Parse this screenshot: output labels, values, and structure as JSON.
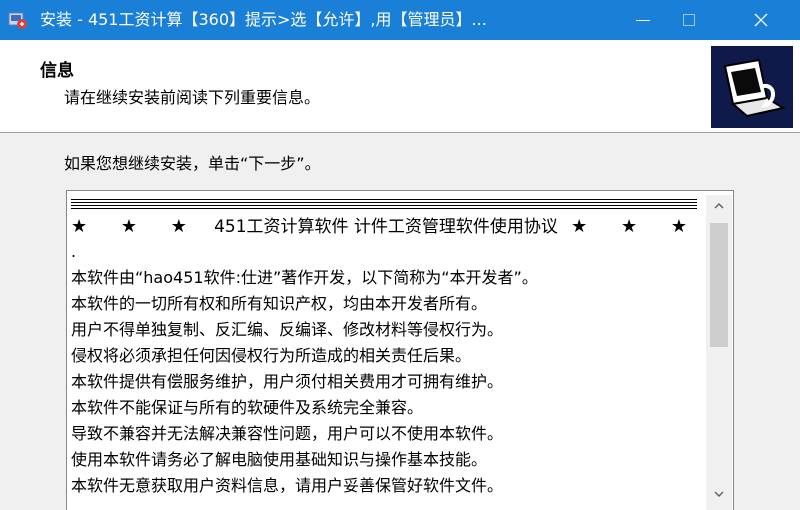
{
  "window": {
    "title": "安装 - 451工资计算【360】提示>选【允许】,用【管理员】..."
  },
  "header": {
    "title": "信息",
    "subtitle": "请在继续安装前阅读下列重要信息。"
  },
  "instruction": "如果您想继续安装，单击“下一步”。",
  "license": {
    "heading_left": "★ ★ ★",
    "heading": "451工资计算软件 计件工资管理软件使用协议",
    "heading_right": "★ ★ ★",
    "dot": ".",
    "lines": [
      "本软件由“hao451软件:仕进”著作开发，以下简称为“本开发者”。",
      "本软件的一切所有权和所有知识产权，均由本开发者所有。",
      "用户不得单独复制、反汇编、反编译、修改材料等侵权行为。",
      "侵权将必须承担任何因侵权行为所造成的相关责任后果。",
      "本软件提供有偿服务维护，用户须付相关费用才可拥有维护。",
      "本软件不能保证与所有的软硬件及系统完全兼容。",
      "导致不兼容并无法解决兼容性问题，用户可以不使用本软件。",
      "使用本软件请务必了解电脑使用基础知识与操作基本技能。",
      "本软件无意获取用户资料信息，请用户妥善保管好软件文件。"
    ]
  },
  "colors": {
    "titlebar": "#1a7fd6",
    "header_bg": "#ffffff",
    "body_bg": "#f0f0f0"
  },
  "icons": {
    "app": "installer-app-icon",
    "wizard": "computer-install-icon"
  }
}
